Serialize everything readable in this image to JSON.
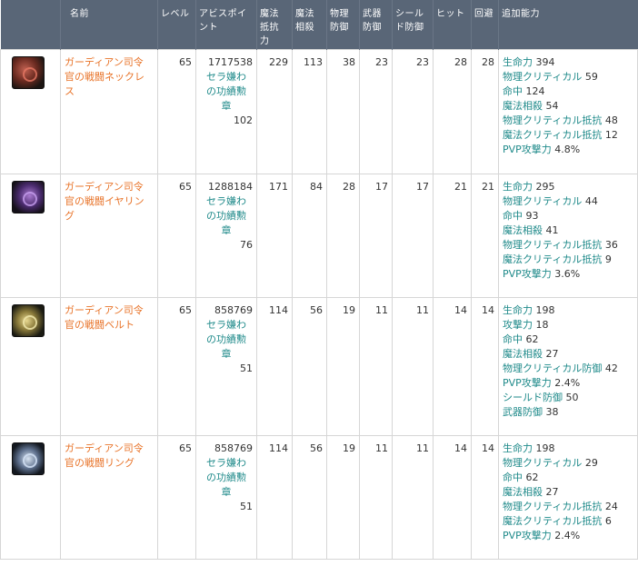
{
  "columns": [
    {
      "line1": "",
      "line2": "",
      "line3": ""
    },
    {
      "line1": "名前",
      "line2": "",
      "line3": ""
    },
    {
      "line1": "レベル",
      "line2": "",
      "line3": ""
    },
    {
      "line1": "アビスポイ",
      "line2": "ント",
      "line3": ""
    },
    {
      "line1": "魔法",
      "line2": "抵抗",
      "line3": "力"
    },
    {
      "line1": "魔法",
      "line2": "相殺",
      "line3": ""
    },
    {
      "line1": "物理",
      "line2": "防御",
      "line3": ""
    },
    {
      "line1": "武器",
      "line2": "防御",
      "line3": ""
    },
    {
      "line1": "シール",
      "line2": "ド防御",
      "line3": ""
    },
    {
      "line1": "ヒット",
      "line2": "",
      "line3": ""
    },
    {
      "line1": "回避",
      "line2": "",
      "line3": ""
    },
    {
      "line1": "追加能力",
      "line2": "",
      "line3": ""
    }
  ],
  "rows": [
    {
      "icon": "ruby-necklace-icon",
      "name_lines": [
        "ガーディアン司令",
        "官の戦闘ネックレス"
      ],
      "level": "65",
      "abyss_points": "1717538",
      "medal_lines": [
        "セラ嫌わ",
        "の功績勲",
        "章"
      ],
      "medal_count": "102",
      "magic_resist": "229",
      "magic_cancel": "113",
      "phys_def": "38",
      "weapon_def": "23",
      "shield_def": "23",
      "hit": "28",
      "evasion": "28",
      "abilities": [
        {
          "label": "生命力",
          "value": "394"
        },
        {
          "label": "物理クリティカル",
          "value": "59"
        },
        {
          "label": "命中",
          "value": "124"
        },
        {
          "label": "魔法相殺",
          "value": "54"
        },
        {
          "label": "物理クリティカル抵抗",
          "value": "48"
        },
        {
          "label": "魔法クリティカル抵抗",
          "value": "12"
        },
        {
          "label": "PVP攻撃力",
          "value": "4.8%"
        }
      ]
    },
    {
      "icon": "purple-earring-icon",
      "name_lines": [
        "ガーディアン司令",
        "官の戦闘イヤリング"
      ],
      "level": "65",
      "abyss_points": "1288184",
      "medal_lines": [
        "セラ嫌わ",
        "の功績勲",
        "章"
      ],
      "medal_count": "76",
      "magic_resist": "171",
      "magic_cancel": "84",
      "phys_def": "28",
      "weapon_def": "17",
      "shield_def": "17",
      "hit": "21",
      "evasion": "21",
      "abilities": [
        {
          "label": "生命力",
          "value": "295"
        },
        {
          "label": "物理クリティカル",
          "value": "44"
        },
        {
          "label": "命中",
          "value": "93"
        },
        {
          "label": "魔法相殺",
          "value": "41"
        },
        {
          "label": "物理クリティカル抵抗",
          "value": "36"
        },
        {
          "label": "魔法クリティカル抵抗",
          "value": "9"
        },
        {
          "label": "PVP攻撃力",
          "value": "3.6%"
        }
      ]
    },
    {
      "icon": "gold-belt-icon",
      "name_lines": [
        "ガーディアン司令",
        "官の戦闘ベルト"
      ],
      "level": "65",
      "abyss_points": "858769",
      "medal_lines": [
        "セラ嫌わ",
        "の功績勲",
        "章"
      ],
      "medal_count": "51",
      "magic_resist": "114",
      "magic_cancel": "56",
      "phys_def": "19",
      "weapon_def": "11",
      "shield_def": "11",
      "hit": "14",
      "evasion": "14",
      "abilities": [
        {
          "label": "生命力",
          "value": "198"
        },
        {
          "label": "攻撃力",
          "value": "18"
        },
        {
          "label": "命中",
          "value": "62"
        },
        {
          "label": "魔法相殺",
          "value": "27"
        },
        {
          "label": "物理クリティカル防御",
          "value": "42"
        },
        {
          "label": "PVP攻撃力",
          "value": "2.4%"
        },
        {
          "label": "シールド防御",
          "value": "50"
        },
        {
          "label": "武器防御",
          "value": "38"
        }
      ]
    },
    {
      "icon": "silver-ring-icon",
      "name_lines": [
        "ガーディアン司令",
        "官の戦闘リング"
      ],
      "level": "65",
      "abyss_points": "858769",
      "medal_lines": [
        "セラ嫌わ",
        "の功績勲",
        "章"
      ],
      "medal_count": "51",
      "magic_resist": "114",
      "magic_cancel": "56",
      "phys_def": "19",
      "weapon_def": "11",
      "shield_def": "11",
      "hit": "14",
      "evasion": "14",
      "abilities": [
        {
          "label": "生命力",
          "value": "198"
        },
        {
          "label": "物理クリティカル",
          "value": "29"
        },
        {
          "label": "命中",
          "value": "62"
        },
        {
          "label": "魔法相殺",
          "value": "27"
        },
        {
          "label": "物理クリティカル抵抗",
          "value": "24"
        },
        {
          "label": "魔法クリティカル抵抗",
          "value": "6"
        },
        {
          "label": "PVP攻撃力",
          "value": "2.4%"
        }
      ]
    }
  ]
}
